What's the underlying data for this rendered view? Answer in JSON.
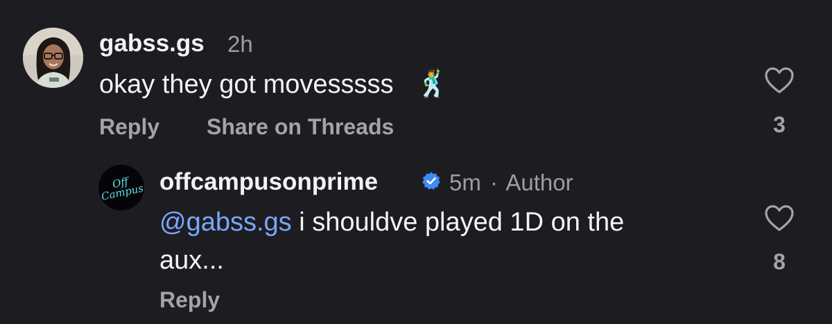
{
  "comments": [
    {
      "username": "gabss.gs",
      "time": "2h",
      "text": "okay they got movesssss",
      "emoji": "🕺",
      "reply_label": "Reply",
      "share_label": "Share on Threads",
      "likes": "3",
      "icons": {
        "avatar": "user-photo-avatar",
        "like": "heart-outline-icon"
      }
    },
    {
      "username": "offcampusonprime",
      "verified": true,
      "time": "5m",
      "separator": "·",
      "author_label": "Author",
      "mention": "@gabss.gs",
      "text_line1": " i shouldve played 1D on the",
      "text_line2": "aux...",
      "reply_label": "Reply",
      "likes": "8",
      "logo_text_1": "Off",
      "logo_text_2": "Campus",
      "icons": {
        "avatar": "brand-logo-avatar",
        "verified": "verified-badge-icon",
        "like": "heart-outline-icon"
      }
    }
  ],
  "colors": {
    "background": "#1d1d21",
    "text": "#f4f4f6",
    "muted": "#a3a3ab",
    "mention": "#7aa6ff",
    "verified": "#3d8bf5",
    "logo": "#5fe0e6"
  }
}
